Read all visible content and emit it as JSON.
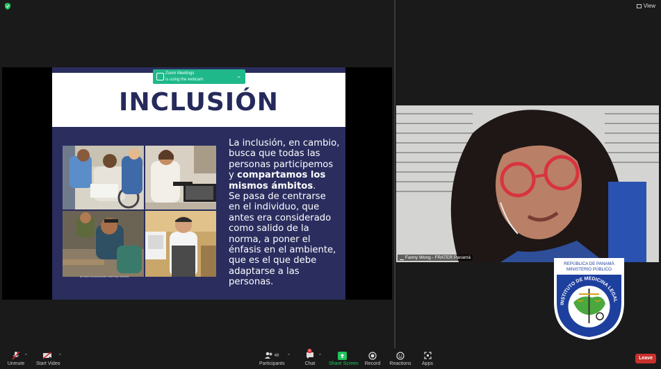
{
  "header": {
    "view_label": "View"
  },
  "colors": {
    "slide_bg": "#2a2d5e",
    "title": "#262a5b",
    "toast": "#1fb88a",
    "leave": "#c9302c",
    "share_screen": "#22c55e"
  },
  "notification": {
    "title": "Zoom Meetings",
    "message": "is using the webcam"
  },
  "slide": {
    "title": "INCLUSIÓN",
    "text_1": "La inclusión, en cambio, busca que todas las personas participemos y ",
    "text_bold": "compartamos los mismos ámbitos",
    "text_2": ".",
    "text_3": "Se pasa de centrarse en el individuo, que antes era considerado como salido de la norma, a poner el énfasis en el ambiente, que es el que debe adaptarse a las personas.",
    "photo_caption": "de Autor desconocido está bajo licencia"
  },
  "participant": {
    "name": "Fanny Wong - FRATER Panamá"
  },
  "seal": {
    "top_line_1": "REPÚBLICA DE PANAMÁ",
    "top_line_2": "MINISTERIO PÚBLICO",
    "ring_text": "INSTITUTO DE MEDICINA LEGAL Y CIENCIAS FORENSES"
  },
  "toolbar": {
    "unmute": "Unmute",
    "start_video": "Start Video",
    "participants": "Participants",
    "participants_count": "48",
    "chat": "Chat",
    "chat_badge": "6",
    "share_screen": "Share Screen",
    "record": "Record",
    "reactions": "Reactions",
    "apps": "Apps",
    "leave": "Leave"
  }
}
